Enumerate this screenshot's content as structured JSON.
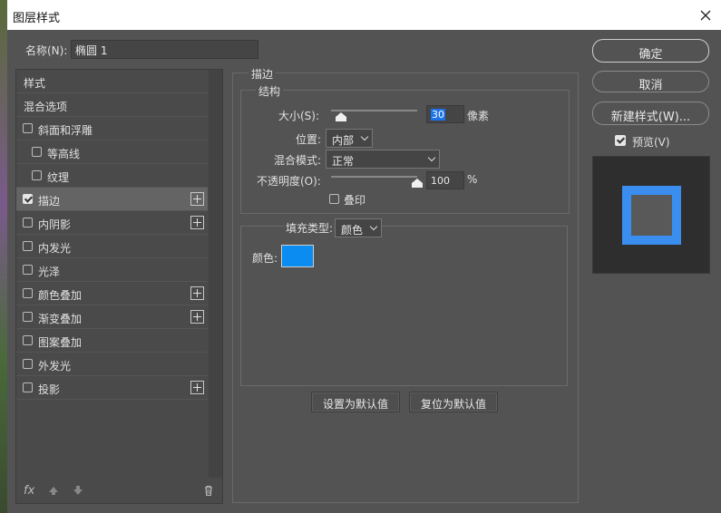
{
  "window": {
    "title": "图层样式"
  },
  "name": {
    "label": "名称(N):",
    "value": "椭圆 1"
  },
  "sidebar": {
    "items": [
      {
        "label": "样式",
        "checkbox": false,
        "checked": false,
        "plus": false,
        "indent": 0
      },
      {
        "label": "混合选项",
        "checkbox": false,
        "checked": false,
        "plus": false,
        "indent": 0
      },
      {
        "label": "斜面和浮雕",
        "checkbox": true,
        "checked": false,
        "plus": false,
        "indent": 0
      },
      {
        "label": "等高线",
        "checkbox": true,
        "checked": false,
        "plus": false,
        "indent": 1
      },
      {
        "label": "纹理",
        "checkbox": true,
        "checked": false,
        "plus": false,
        "indent": 1
      },
      {
        "label": "描边",
        "checkbox": true,
        "checked": true,
        "plus": true,
        "indent": 0,
        "selected": true
      },
      {
        "label": "内阴影",
        "checkbox": true,
        "checked": false,
        "plus": true,
        "indent": 0
      },
      {
        "label": "内发光",
        "checkbox": true,
        "checked": false,
        "plus": false,
        "indent": 0
      },
      {
        "label": "光泽",
        "checkbox": true,
        "checked": false,
        "plus": false,
        "indent": 0
      },
      {
        "label": "颜色叠加",
        "checkbox": true,
        "checked": false,
        "plus": true,
        "indent": 0
      },
      {
        "label": "渐变叠加",
        "checkbox": true,
        "checked": false,
        "plus": true,
        "indent": 0
      },
      {
        "label": "图案叠加",
        "checkbox": true,
        "checked": false,
        "plus": false,
        "indent": 0
      },
      {
        "label": "外发光",
        "checkbox": true,
        "checked": false,
        "plus": false,
        "indent": 0
      },
      {
        "label": "投影",
        "checkbox": true,
        "checked": false,
        "plus": true,
        "indent": 0
      }
    ],
    "footer": {
      "fx": "fx",
      "up_icon": "arrow-up-icon",
      "down_icon": "arrow-down-icon",
      "trash_icon": "trash-icon"
    }
  },
  "stroke": {
    "section_title": "描边",
    "structure_title": "结构",
    "size": {
      "label": "大小(S):",
      "value": "30",
      "unit": "像素",
      "slider_fraction": 0.12
    },
    "position": {
      "label": "位置:",
      "value": "内部"
    },
    "blend_mode": {
      "label": "混合模式:",
      "value": "正常"
    },
    "opacity": {
      "label": "不透明度(O):",
      "value": "100",
      "unit": "%",
      "slider_fraction": 1.0
    },
    "overprint": {
      "label": "叠印",
      "checked": false
    },
    "fill_type": {
      "label": "填充类型:",
      "value": "颜色"
    },
    "color": {
      "label": "颜色:",
      "hex": "#0a8cf0"
    },
    "set_default_label": "设置为默认值",
    "reset_default_label": "复位为默认值"
  },
  "actions": {
    "ok_label": "确定",
    "cancel_label": "取消",
    "new_style_label": "新建样式(W)...",
    "preview_label": "预览(V)",
    "preview_checked": true
  },
  "colors": {
    "accent": "#3a8ef0",
    "stroke_color": "#0a8cf0",
    "panel_bg": "#535353"
  }
}
